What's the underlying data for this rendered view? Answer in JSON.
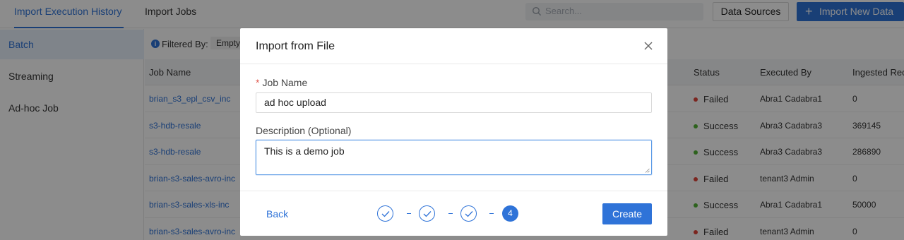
{
  "tabs": [
    {
      "label": "Import Execution History"
    },
    {
      "label": "Import Jobs"
    }
  ],
  "search": {
    "placeholder": "Search..."
  },
  "toolbar": {
    "data_sources_label": "Data Sources",
    "import_new_label": "Import New Data"
  },
  "sidebar": {
    "items": [
      {
        "label": "Batch"
      },
      {
        "label": "Streaming"
      },
      {
        "label": "Ad-hoc Job"
      }
    ]
  },
  "filter": {
    "label": "Filtered By:",
    "chip": "Empty"
  },
  "table": {
    "headers": {
      "job_name": "Job Name",
      "status": "Status",
      "executed_by": "Executed By",
      "ingested": "Ingested Rec"
    },
    "rows": [
      {
        "job_name": "brian_s3_epl_csv_inc",
        "status": "Failed",
        "executed_by": "Abra1 Cadabra1",
        "ingested": "0"
      },
      {
        "job_name": "s3-hdb-resale",
        "status": "Success",
        "executed_by": "Abra3 Cadabra3",
        "ingested": "369145"
      },
      {
        "job_name": "s3-hdb-resale",
        "status": "Success",
        "executed_by": "Abra3 Cadabra3",
        "ingested": "286890"
      },
      {
        "job_name": "brian-s3-sales-avro-inc",
        "status": "Failed",
        "executed_by": "tenant3 Admin",
        "ingested": "0"
      },
      {
        "job_name": "brian-s3-sales-xls-inc",
        "status": "Success",
        "executed_by": "Abra1 Cadabra1",
        "ingested": "50000"
      },
      {
        "job_name": "brian-s3-sales-avro-inc",
        "status": "Failed",
        "executed_by": "tenant3 Admin",
        "ingested": "0"
      }
    ]
  },
  "colors": {
    "accent": "#2f73d8",
    "failed": "#e0443a",
    "success": "#52b236"
  },
  "modal": {
    "title": "Import from File",
    "job_name": {
      "label": "Job Name",
      "required_mark": "*",
      "value": "ad hoc upload"
    },
    "description": {
      "label": "Description (Optional)",
      "value": "This is a demo job"
    },
    "back_label": "Back",
    "create_label": "Create",
    "steps": {
      "current": "4",
      "total": 4,
      "separator": "-"
    }
  }
}
